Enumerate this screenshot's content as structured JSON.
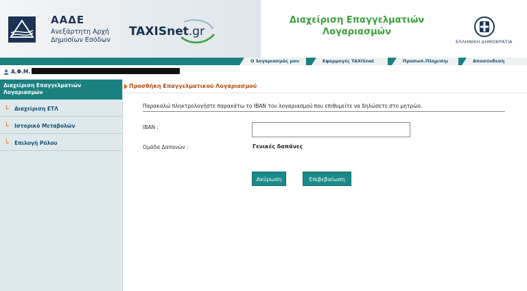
{
  "header": {
    "aade_name": "ΑΑΔΕ",
    "aade_sub_line1": "Ανεξάρτητη Αρχή",
    "aade_sub_line2": "Δημοσίων Εσόδων",
    "taxis_main": "TAXISnet",
    "taxis_tld": ".gr",
    "title_line1": "Διαχείριση Επαγγελματιών",
    "title_line2": "Λογαριασμών",
    "gov_label": "ΕΛΛΗΝΙΚΗ ΔΗΜΟΚΡΑΤΙΑ"
  },
  "nav": {
    "items": [
      {
        "label": "Ο λογαριασμός μου"
      },
      {
        "label": "Εφαρμογές TAXISnet"
      },
      {
        "label": "Προσωπ.Πληρ/σηι"
      },
      {
        "label": "Αποσύνδεση"
      }
    ]
  },
  "user": {
    "label": "Α.Φ.Μ."
  },
  "sidebar": {
    "header": "Διαχείριση Επαγγελματιών Λογαριασμών",
    "items": [
      {
        "label": "Διαχείριση ΕΤΛ"
      },
      {
        "label": "Ιστορικό Μεταβολών"
      },
      {
        "label": "Επιλογή Ρόλου"
      }
    ]
  },
  "main": {
    "title": "Προσθήκη Επαγγελματικού Λογαριασμού",
    "instruction": "Παρακαλώ πληκτρολογήστε παρακάτω το IBAN του λογαριασμού που επιθυμείτε να δηλώσετε στο μητρώο.",
    "iban_label": "IBAN :",
    "iban_value": "",
    "group_label": "Ομάδα Δαπανών :",
    "group_value": "Γενικές δαπάνες",
    "cancel_label": "Ακύρωση",
    "confirm_label": "Επιβεβαίωση"
  },
  "colors": {
    "accent_teal": "#1a8080",
    "title_green": "#3aa23a",
    "heading_orange": "#b04a10",
    "navy": "#1c3355"
  }
}
